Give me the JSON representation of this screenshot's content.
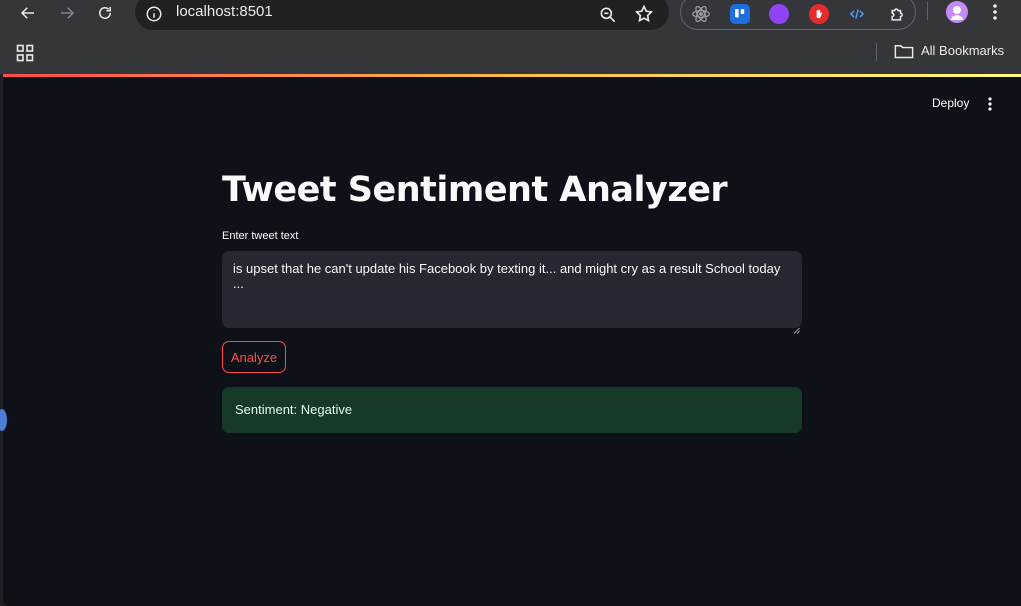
{
  "browser": {
    "url": "localhost:8501",
    "bookmarks_label": "All Bookmarks",
    "icons": {
      "back": "back-arrow-icon",
      "forward": "forward-arrow-icon",
      "reload": "reload-icon",
      "site_info": "info-icon",
      "zoom": "zoom-icon",
      "bookmark_star": "star-icon",
      "apps": "apps-grid-icon",
      "folder": "folder-icon",
      "menu": "kebab-menu-icon"
    },
    "extensions": [
      {
        "name": "react-devtools-icon",
        "color": "#35363a",
        "fg": "#9aa0a6"
      },
      {
        "name": "trello-icon",
        "color": "#1d6fe0"
      },
      {
        "name": "web-extension-purple-icon",
        "color": "#8e44f0"
      },
      {
        "name": "hand-stop-icon",
        "color": "#e52b2b"
      },
      {
        "name": "code-tags-icon",
        "color": "#35363a",
        "fg": "#4ea1ff"
      },
      {
        "name": "extensions-puzzle-icon",
        "color": "#35363a",
        "fg": "#e8eaed"
      }
    ]
  },
  "app": {
    "deploy_label": "Deploy",
    "title": "Tweet Sentiment Analyzer",
    "input_label": "Enter tweet text",
    "input_value": "is upset that he can't update his Facebook by texting it... and might cry as a result School today ...",
    "analyze_label": "Analyze",
    "result_text": "Sentiment: Negative",
    "colors": {
      "background": "#0e1117",
      "accent": "#ff4b4b",
      "success_bg": "#173928",
      "input_bg": "#262730"
    }
  }
}
